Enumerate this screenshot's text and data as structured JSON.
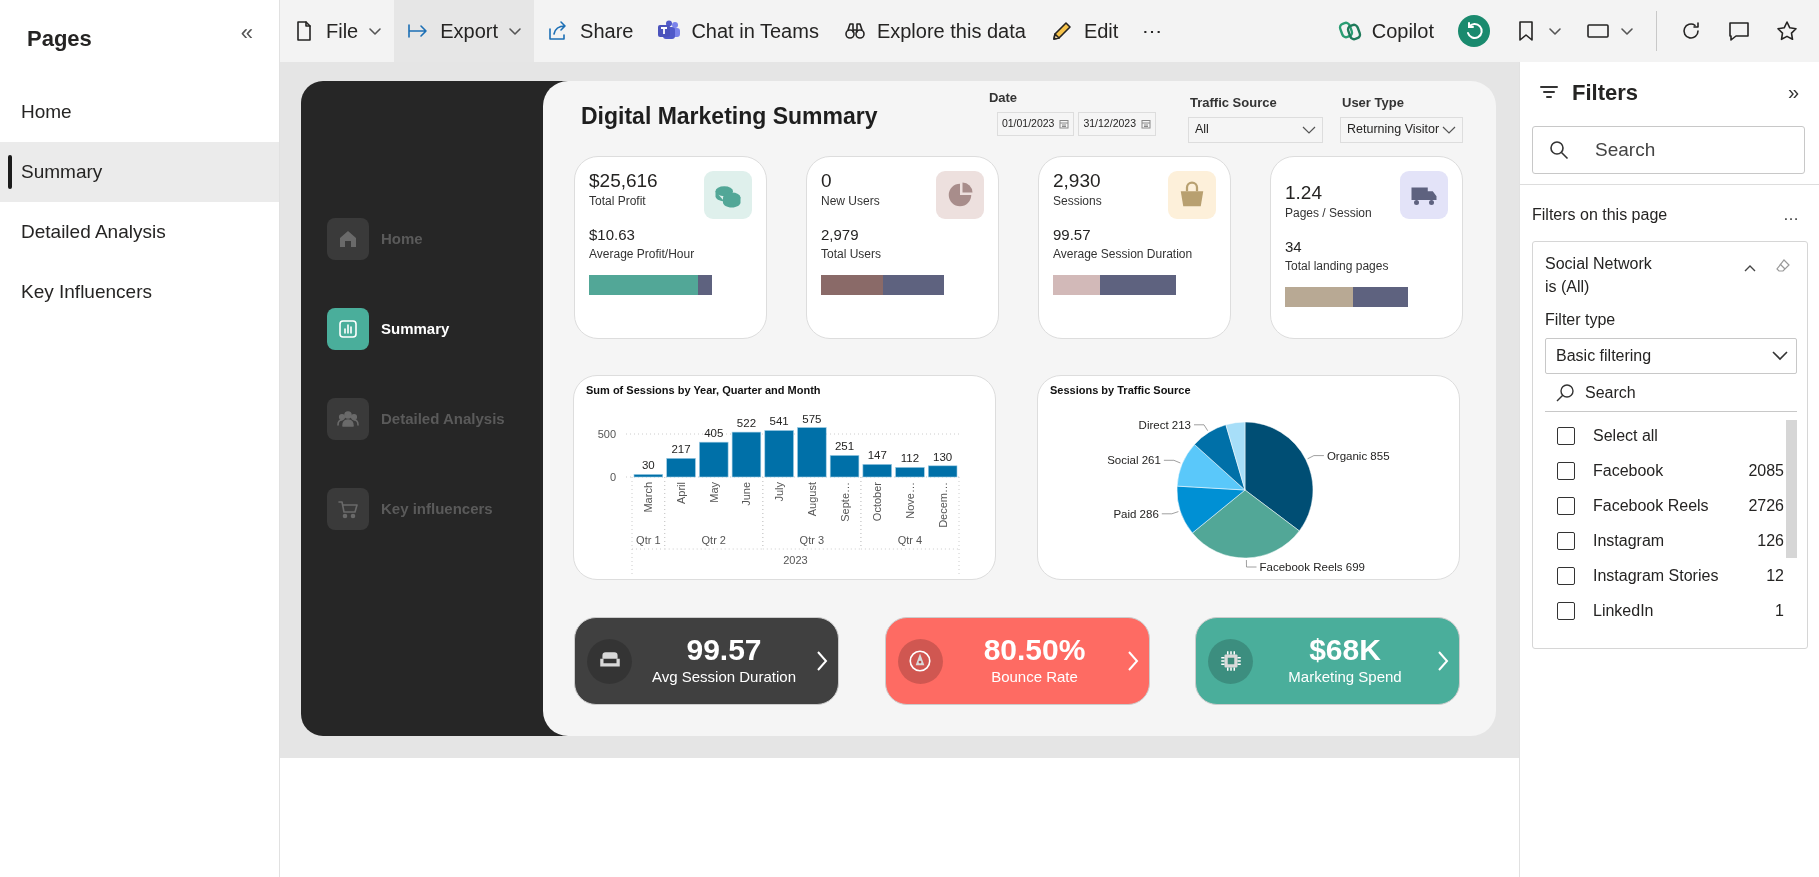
{
  "pages_pane": {
    "title": "Pages",
    "collapse": "«",
    "items": [
      {
        "label": "Home",
        "selected": false
      },
      {
        "label": "Summary",
        "selected": true
      },
      {
        "label": "Detailed Analysis",
        "selected": false
      },
      {
        "label": "Key Influencers",
        "selected": false
      }
    ]
  },
  "toolbar": {
    "items": [
      {
        "label": "File",
        "caret": true,
        "highlighted": false
      },
      {
        "label": "Export",
        "caret": true,
        "highlighted": true
      },
      {
        "label": "Share",
        "caret": false,
        "highlighted": false
      },
      {
        "label": "Chat in Teams",
        "caret": false,
        "highlighted": false
      },
      {
        "label": "Explore this data",
        "caret": false,
        "highlighted": false
      },
      {
        "label": "Edit",
        "caret": false,
        "highlighted": false
      }
    ],
    "more": "⋯",
    "copilot": "Copilot"
  },
  "report": {
    "nav": [
      {
        "label": "Home",
        "selected": false
      },
      {
        "label": "Summary",
        "selected": true
      },
      {
        "label": "Detailed Analysis",
        "selected": false
      },
      {
        "label": "Key influencers",
        "selected": false
      }
    ],
    "title": "Digital Marketing Summary",
    "date_slicer": {
      "label": "Date",
      "start": "01/01/2023",
      "end": "31/12/2023"
    },
    "dropdowns": [
      {
        "label": "Traffic Source",
        "value": "All"
      },
      {
        "label": "User Type",
        "value": "Returning Visitor"
      }
    ],
    "kpi_cards": [
      {
        "value": "$25,616",
        "label": "Total Profit",
        "secondary_value": "$10.63",
        "secondary_label": "Average Profit/Hour",
        "bar": {
          "level": 0.89,
          "color": "#52a797"
        }
      },
      {
        "value": "0",
        "label": "New Users",
        "secondary_value": "2,979",
        "secondary_label": "Total Users",
        "bar": {
          "level": 0.5,
          "color": "#8a6a68"
        }
      },
      {
        "value": "2,930",
        "label": "Sessions",
        "secondary_value": "99.57",
        "secondary_label": "Average Session Duration",
        "bar": {
          "level": 0.38,
          "color": "#d2b9b8"
        }
      },
      {
        "value": "1.24",
        "label": "Pages / Session",
        "secondary_value": "34",
        "secondary_label": "Total landing pages",
        "bar": {
          "level": 0.55,
          "color": "#b8a994"
        }
      }
    ],
    "charts": [
      {
        "chart_data": {
          "type": "bar",
          "title": "Sum of Sessions by Year, Quarter and Month",
          "values": [
            30,
            217,
            405,
            522,
            541,
            575,
            251,
            147,
            112,
            130
          ],
          "ylim": [
            0,
            600
          ],
          "yticks": [
            0,
            500
          ],
          "data_labels": true
        },
        "x_axis": [
          {
            "label": "2023",
            "children": [
              {
                "label": "Qtr 1",
                "children": [
                  {
                    "label": "March"
                  }
                ]
              },
              {
                "label": "Qtr 2",
                "children": [
                  {
                    "label": "April"
                  },
                  {
                    "label": "May"
                  },
                  {
                    "label": "June"
                  }
                ]
              },
              {
                "label": "Qtr 3",
                "children": [
                  {
                    "label": "July"
                  },
                  {
                    "label": "August"
                  },
                  {
                    "label": "Septe…"
                  }
                ]
              },
              {
                "label": "Qtr 4",
                "children": [
                  {
                    "label": "October"
                  },
                  {
                    "label": "Nove…"
                  },
                  {
                    "label": "Decem…"
                  }
                ]
              }
            ]
          }
        ]
      },
      {
        "chart_data": {
          "type": "pie",
          "title": "Sessions by Traffic Source",
          "categories": [
            "Organic 855",
            "Facebook Reels 699",
            "Paid 286",
            "Social 261",
            "Direct 213",
            null
          ],
          "values": [
            855,
            699,
            286,
            261,
            213,
            110
          ],
          "colors": [
            "#004e74",
            "#52a797",
            "#0090d4",
            "#5ac8fa",
            "#0070a8",
            "#a7def8"
          ]
        }
      }
    ],
    "metric_cards": [
      {
        "value": "99.57",
        "label": "Avg Session Duration",
        "color": "#404040"
      },
      {
        "value": "80.50%",
        "label": "Bounce Rate",
        "color": "#fe6b63"
      },
      {
        "value": "$68K",
        "label": "Marketing Spend",
        "color": "#4aae9b"
      }
    ]
  },
  "filters_pane": {
    "title": "Filters",
    "expand": "»",
    "search_placeholder": "Search",
    "section": "Filters on this page",
    "section_more": "…",
    "filter": {
      "field": "Social Network",
      "condition": "is (All)",
      "expanded": true,
      "type_label": "Filter type",
      "type_value": "Basic filtering",
      "search_placeholder": "Search",
      "options": [
        {
          "label": "Select all",
          "checked": false
        },
        {
          "label": "Facebook",
          "count": "2085",
          "checked": false
        },
        {
          "label": "Facebook Reels",
          "count": "2726",
          "checked": false
        },
        {
          "label": "Instagram",
          "count": "126",
          "checked": false
        },
        {
          "label": "Instagram Stories",
          "count": "12",
          "checked": false
        },
        {
          "label": "LinkedIn",
          "count": "1",
          "checked": false
        }
      ]
    }
  }
}
